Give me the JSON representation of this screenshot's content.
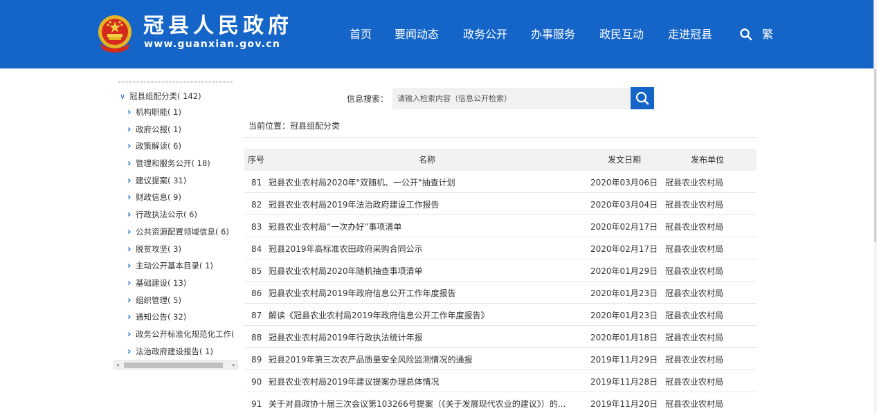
{
  "header": {
    "site_title": "冠县人民政府",
    "site_url": "www.guanxian.gov.cn",
    "nav": [
      {
        "label": "首页"
      },
      {
        "label": "要闻动态"
      },
      {
        "label": "政务公开"
      },
      {
        "label": "办事服务"
      },
      {
        "label": "政民互动"
      },
      {
        "label": "走进冠县"
      }
    ],
    "search_icon": "search-icon",
    "lang_toggle": "繁",
    "brand_color": "#1565c8"
  },
  "sidebar": {
    "root": {
      "label": "冠县组配分类",
      "count": "( 142)"
    },
    "items": [
      {
        "label": "机构职能",
        "count": "( 1)"
      },
      {
        "label": "政府公报",
        "count": "( 1)"
      },
      {
        "label": "政策解读",
        "count": "( 6)"
      },
      {
        "label": "管理和服务公开",
        "count": "( 18)"
      },
      {
        "label": "建议提案",
        "count": "( 31)"
      },
      {
        "label": "财政信息",
        "count": "( 9)"
      },
      {
        "label": "行政执法公示",
        "count": "( 6)"
      },
      {
        "label": "公共资源配置领域信息",
        "count": "( 6)"
      },
      {
        "label": "脱贫攻坚",
        "count": "( 3)"
      },
      {
        "label": "主动公开基本目录",
        "count": "( 1)"
      },
      {
        "label": "基础建设",
        "count": "( 13)"
      },
      {
        "label": "组织管理",
        "count": "( 5)"
      },
      {
        "label": "通知公告",
        "count": "( 32)"
      },
      {
        "label": "政务公开标准化规范化工作",
        "count": "("
      },
      {
        "label": "法治政府建设报告",
        "count": "( 1)"
      }
    ]
  },
  "search": {
    "label": "信息搜索：",
    "placeholder": "请输入检索内容（信息公开检索）"
  },
  "breadcrumb": "当前位置：冠县组配分类",
  "table": {
    "headers": {
      "num": "序号",
      "title": "名称",
      "date": "发文日期",
      "unit": "发布单位"
    },
    "rows": [
      {
        "num": "81",
        "title": "冠县农业农村局2020年\"双随机、一公开\"抽查计划",
        "date": "2020年03月06日",
        "unit": "冠县农业农村局"
      },
      {
        "num": "82",
        "title": "冠县农业农村局2019年法治政府建设工作报告",
        "date": "2020年03月04日",
        "unit": "冠县农业农村局"
      },
      {
        "num": "83",
        "title": "冠县农业农村局“一次办好”事项清单",
        "date": "2020年02月17日",
        "unit": "冠县农业农村局"
      },
      {
        "num": "84",
        "title": "冠县2019年高标准农田政府采购合同公示",
        "date": "2020年02月17日",
        "unit": "冠县农业农村局"
      },
      {
        "num": "85",
        "title": "冠县农业农村局2020年随机抽查事项清单",
        "date": "2020年01月29日",
        "unit": "冠县农业农村局"
      },
      {
        "num": "86",
        "title": "冠县农业农村局2019年政府信息公开工作年度报告",
        "date": "2020年01月23日",
        "unit": "冠县农业农村局"
      },
      {
        "num": "87",
        "title": "解读《冠县农业农村局2019年政府信息公开工作年度报告》",
        "date": "2020年01月23日",
        "unit": "冠县农业农村局"
      },
      {
        "num": "88",
        "title": "冠县农业农村局2019年行政执法统计年报",
        "date": "2020年01月18日",
        "unit": "冠县农业农村局"
      },
      {
        "num": "89",
        "title": "冠县2019年第三次农产品质量安全风险监测情况的通报",
        "date": "2019年11月29日",
        "unit": "冠县农业农村局"
      },
      {
        "num": "90",
        "title": "冠县农业农村局2019年建议提案办理总体情况",
        "date": "2019年11月28日",
        "unit": "冠县农业农村局"
      },
      {
        "num": "91",
        "title": "关于对县政协十届三次会议第103266号提案（《关于发展现代农业的建议》）的...",
        "date": "2019年11月20日",
        "unit": "冠县农业农村局"
      }
    ]
  }
}
